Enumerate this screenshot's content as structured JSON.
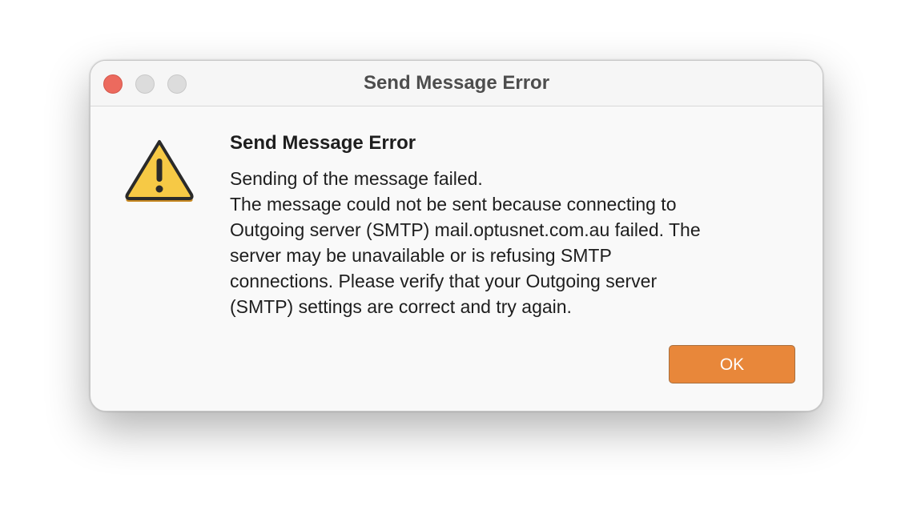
{
  "window": {
    "title": "Send Message Error",
    "controls": [
      "close",
      "minimize",
      "zoom"
    ]
  },
  "dialog": {
    "icon": "warning-triangle-icon",
    "heading": "Send Message Error",
    "message": "Sending of the message failed.\nThe message could not be sent because connecting to\nOutgoing server (SMTP) mail.optusnet.com.au failed. The\nserver may be unavailable or is refusing SMTP\nconnections. Please verify that your Outgoing server\n(SMTP) settings are correct and try again.",
    "ok_label": "OK"
  },
  "colors": {
    "close_button": "#ec6a5e",
    "ok_button": "#e8873a",
    "warning_fill": "#f6c945",
    "warning_outline": "#2a2a2a"
  }
}
